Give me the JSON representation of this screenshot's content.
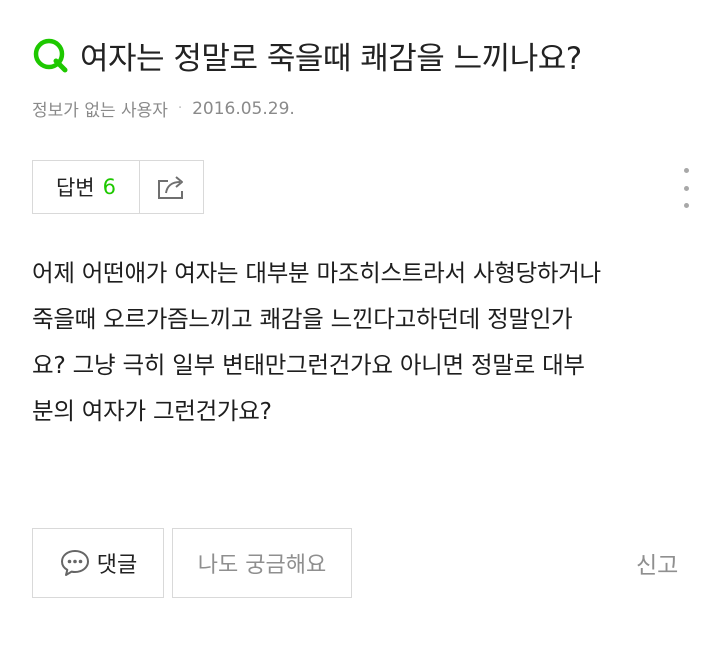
{
  "question": {
    "title": "여자는 정말로 죽을때 쾌감을 느끼나요?",
    "author": "정보가 없는 사용자",
    "separator": "·",
    "date": "2016.05.29.",
    "body": "어제 어떤애가 여자는 대부분 마조히스트라서 사형당하거나\n죽을때 오르가즘느끼고 쾌감을 느낀다고하던데 정말인가\n요? 그냥 극히 일부 변태만그런건가요 아니면 정말로 대부\n분의 여자가 그런건가요?"
  },
  "answers": {
    "label": "답변",
    "count": "6"
  },
  "actions": {
    "comment_label": "댓글",
    "curious_label": "나도 궁금해요",
    "report_label": "신고"
  },
  "icons": {
    "question": "q-question-icon",
    "share": "share-icon",
    "more": "more-vertical-icon",
    "comment": "speech-bubble-icon"
  },
  "colors": {
    "accent": "#1ec800",
    "muted_text": "#8a8a8a",
    "border": "#d9d9d9"
  }
}
